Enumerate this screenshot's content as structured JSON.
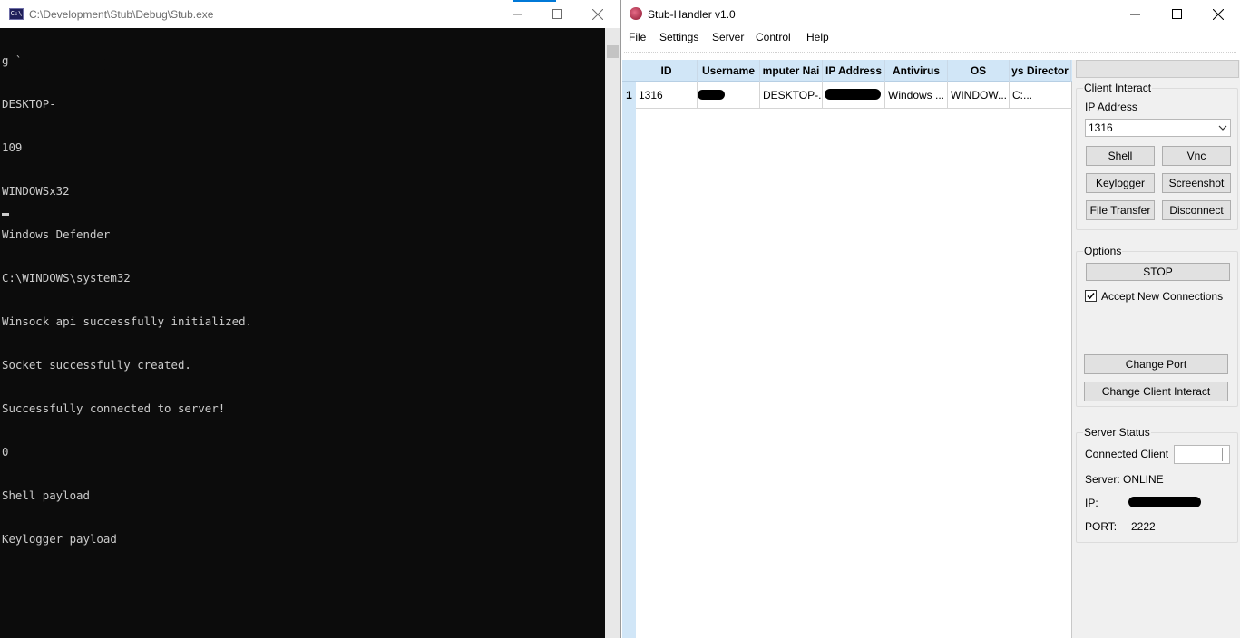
{
  "console": {
    "title": "C:\\Development\\Stub\\Debug\\Stub.exe",
    "icon": "console-app-icon",
    "icon_text": "C:\\",
    "lines": [
      "g ` ",
      "DESKTOP-",
      "109",
      "WINDOWSx32",
      "Windows Defender",
      "C:\\WINDOWS\\system32",
      "Winsock api successfully initialized.",
      "Socket successfully created.",
      "Successfully connected to server!",
      "0",
      "Shell payload",
      "Keylogger payload"
    ]
  },
  "handler": {
    "title": "Stub-Handler v1.0",
    "menu": [
      "File",
      "Settings",
      "Server",
      "Control",
      "Help"
    ],
    "columns": [
      "ID",
      "Username",
      "mputer Nai",
      "IP Address",
      "Antivirus",
      "OS",
      "ys Director"
    ],
    "rows": [
      {
        "num": "1",
        "id": "1316",
        "computer": "DESKTOP-...",
        "antivirus": "Windows ...",
        "os": "WINDOW...",
        "dir": "C:..."
      }
    ],
    "client_interact": {
      "title": "Client Interact",
      "ip_label": "IP Address",
      "selected": "1316",
      "buttons": [
        "Shell",
        "Vnc",
        "Keylogger",
        "Screenshot",
        "File Transfer",
        "Disconnect"
      ]
    },
    "options": {
      "title": "Options",
      "stop_label": "STOP",
      "accept_label": "Accept New Connections",
      "accept_checked": true,
      "change_port": "Change Port",
      "change_client": "Change Client Interact"
    },
    "server_status": {
      "title": "Server Status",
      "connected_label": "Connected Client",
      "server_text": "Server: ONLINE",
      "ip_label": "IP:",
      "port_label": "PORT:",
      "port_value": "2222"
    }
  }
}
